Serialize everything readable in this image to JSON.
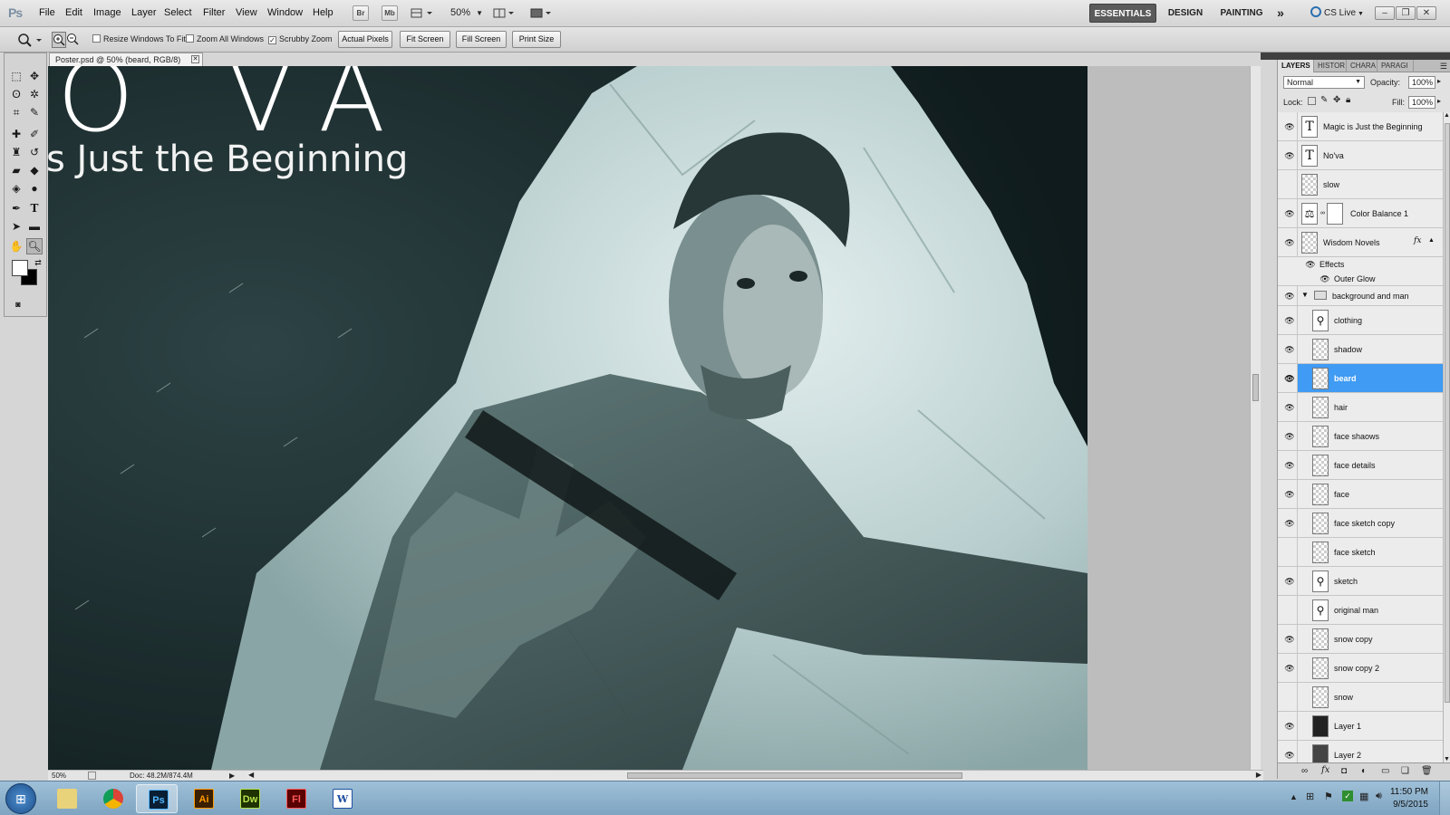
{
  "app": {
    "logo": "Ps"
  },
  "menus": [
    "File",
    "Edit",
    "Image",
    "Layer",
    "Select",
    "Filter",
    "View",
    "Window",
    "Help"
  ],
  "menubar_controls": {
    "bridge_label": "Br",
    "minibridge_label": "Mb",
    "zoom_value": "50%"
  },
  "workspaces": {
    "essentials": "ESSENTIALS",
    "design": "DESIGN",
    "painting": "PAINTING",
    "more": "»",
    "cs_live": "CS Live"
  },
  "options_bar": {
    "resize_windows": "Resize Windows To Fit",
    "zoom_all_windows": "Zoom All Windows",
    "scrubby_zoom": "Scrubby Zoom",
    "actual_pixels": "Actual Pixels",
    "fit_screen": "Fit Screen",
    "fill_screen": "Fill Screen",
    "print_size": "Print Size"
  },
  "document": {
    "tab_title": "Poster.psd @ 50% (beard, RGB/8)",
    "art_title": "O VA",
    "art_subtitle": "s Just the Beginning",
    "zoom": "50%",
    "doc_size": "Doc: 48.2M/874.4M"
  },
  "layers_panel": {
    "tabs": [
      "LAYERS",
      "HISTOR",
      "CHARA",
      "PARAGI"
    ],
    "blend_mode": "Normal",
    "opacity_label": "Opacity:",
    "opacity_value": "100%",
    "lock_label": "Lock:",
    "fill_label": "Fill:",
    "fill_value": "100%",
    "layers": [
      {
        "name": "Magic is Just the Beginning",
        "visible": true,
        "kind": "text"
      },
      {
        "name": "No'va",
        "visible": true,
        "kind": "text"
      },
      {
        "name": "slow",
        "visible": false,
        "kind": "pixel"
      },
      {
        "name": "Color Balance 1",
        "visible": true,
        "kind": "adjustment"
      },
      {
        "name": "Wisdom Novels",
        "visible": true,
        "kind": "smart",
        "fx": true
      },
      {
        "name": "Effects",
        "visible": true,
        "kind": "effects"
      },
      {
        "name": "Outer Glow",
        "visible": true,
        "kind": "effect"
      },
      {
        "name": "background and man",
        "visible": true,
        "kind": "group"
      },
      {
        "name": "clothing",
        "visible": true,
        "kind": "pixel-art"
      },
      {
        "name": "shadow",
        "visible": true,
        "kind": "pixel"
      },
      {
        "name": "beard",
        "visible": true,
        "kind": "pixel",
        "selected": true
      },
      {
        "name": "hair",
        "visible": true,
        "kind": "pixel"
      },
      {
        "name": "face shaows",
        "visible": true,
        "kind": "pixel"
      },
      {
        "name": "face details",
        "visible": true,
        "kind": "pixel"
      },
      {
        "name": "face",
        "visible": true,
        "kind": "pixel"
      },
      {
        "name": "face sketch copy",
        "visible": true,
        "kind": "pixel"
      },
      {
        "name": "face sketch",
        "visible": false,
        "kind": "pixel"
      },
      {
        "name": "sketch",
        "visible": true,
        "kind": "pixel-art"
      },
      {
        "name": "original man",
        "visible": false,
        "kind": "pixel-art"
      },
      {
        "name": "snow copy",
        "visible": true,
        "kind": "pixel"
      },
      {
        "name": "snow copy 2",
        "visible": true,
        "kind": "pixel"
      },
      {
        "name": "snow",
        "visible": false,
        "kind": "pixel"
      },
      {
        "name": "Layer 1",
        "visible": true,
        "kind": "pixel-dark"
      },
      {
        "name": "Layer 2",
        "visible": true,
        "kind": "pixel-dark"
      }
    ]
  },
  "taskbar": {
    "apps": [
      {
        "label": "",
        "icon": "explorer-icon"
      },
      {
        "label": "",
        "icon": "chrome-icon"
      },
      {
        "label": "Ps",
        "icon": "photoshop-icon",
        "active": true
      },
      {
        "label": "Ai",
        "icon": "illustrator-icon"
      },
      {
        "label": "Dw",
        "icon": "dreamweaver-icon"
      },
      {
        "label": "Fl",
        "icon": "flash-icon"
      },
      {
        "label": "W",
        "icon": "word-icon"
      }
    ],
    "time": "11:50 PM",
    "date": "9/5/2015"
  },
  "colors": {
    "accent_selected": "#3f9bf3",
    "essentials_bg": "#5b5b5b"
  }
}
